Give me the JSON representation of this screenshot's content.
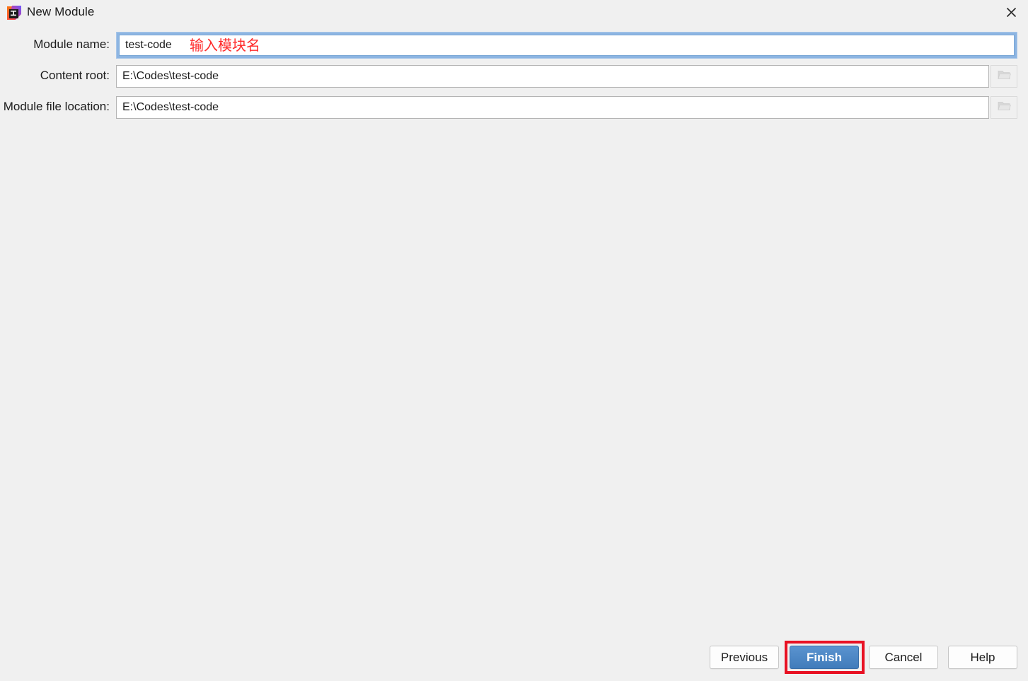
{
  "window": {
    "title": "New Module",
    "app_icon": "intellij-idea-icon",
    "close_icon": "close-icon"
  },
  "form": {
    "rows": [
      {
        "label": "Module name:",
        "value": "test-code",
        "annotation": "输入模块名",
        "annotation_color": "#ff2a2a",
        "focused": true,
        "has_browse": false
      },
      {
        "label": "Content root:",
        "value": "E:\\Codes\\test-code",
        "focused": false,
        "has_browse": true,
        "browse_icon": "folder-icon"
      },
      {
        "label": "Module file location:",
        "value": "E:\\Codes\\test-code",
        "focused": false,
        "has_browse": true,
        "browse_icon": "folder-icon"
      }
    ]
  },
  "footer": {
    "previous_label": "Previous",
    "finish_label": "Finish",
    "cancel_label": "Cancel",
    "help_label": "Help",
    "finish_highlight_color": "#e81123",
    "finish_button_color": "#4a86c5"
  }
}
